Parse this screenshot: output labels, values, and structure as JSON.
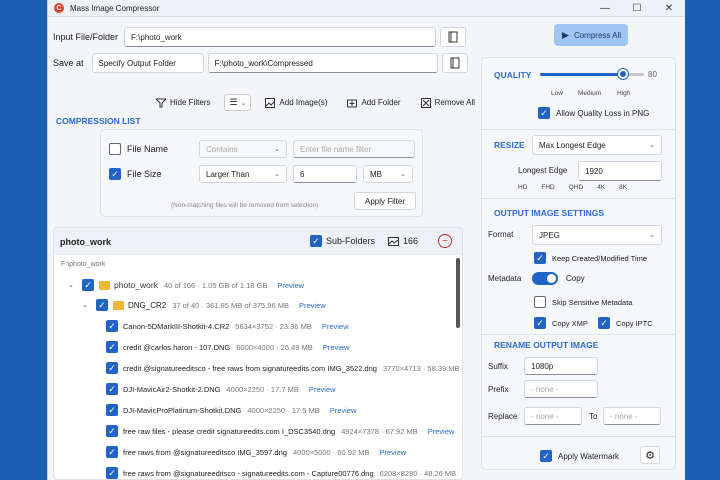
{
  "window": {
    "title": "Mass Image Compressor"
  },
  "input": {
    "label": "Input File/Folder",
    "value": "F:\\photo_work"
  },
  "save": {
    "label": "Save at",
    "mode": "Specify Output Folder",
    "value": "F:\\photo_work\\Compressed"
  },
  "compress_all": "Compress All",
  "toolbar": {
    "hide_filters": "Hide Filters",
    "add_images": "Add Image(s)",
    "add_folder": "Add Folder",
    "remove_all": "Remove All"
  },
  "compression_list": {
    "title": "COMPRESSION LIST",
    "filename": {
      "label": "File Name",
      "op": "Contains",
      "placeholder": "Enter file name filter"
    },
    "filesize": {
      "label": "File Size",
      "op": "Larger Than",
      "value": "6",
      "unit": "MB"
    },
    "note": "(Non-matching files will be removed from selection)",
    "apply": "Apply Filter"
  },
  "tree": {
    "root": "photo_work",
    "subfolders_label": "Sub-Folders",
    "count": "166",
    "path": "F:\\photo_work",
    "rows": [
      {
        "name": "photo_work",
        "size": "40 of 166 · 1.05 GB of 1.18 GB",
        "preview": "Preview"
      },
      {
        "name": "DNG_CR2",
        "size": "37 of 40 · 361.85 MB of 375.96 MB",
        "preview": "Preview"
      },
      {
        "name": "Canon-5DMarkIII-Shotkit-4.CR2",
        "size": "5634×3752 · 23.36 MB",
        "preview": "Preview"
      },
      {
        "name": "credit @carlos.haron - 107.DNG",
        "size": "6000×4000 · 26.49 MB",
        "preview": "Preview"
      },
      {
        "name": "credit @signatureeditsco - free raws from signatureedits.com IMG_3522.dng",
        "size": "3770×4713 · 58.39 MB",
        "preview": ""
      },
      {
        "name": "DJI-MavicAir2-Shotkit-2.DNG",
        "size": "4000×2250 · 17.7 MB",
        "preview": "Preview"
      },
      {
        "name": "DJI-MavicProPlatinum-Shotkit.DNG",
        "size": "4000×2250 · 17.5 MB",
        "preview": "Preview"
      },
      {
        "name": "free raw files - please credit signatureedits.com I_DSC3540.dng",
        "size": "4924×7378 · 67.92 MB",
        "preview": "Preview"
      },
      {
        "name": "free raws from @signatureeditsco IMG_3597.dng",
        "size": "4000×5000 · 60.92 MB",
        "preview": "Preview"
      },
      {
        "name": "free raws from @signatureeditsco - signatureedits.com - Capture00776.dng",
        "size": "6208×8280 · 48.26 MB",
        "preview": ""
      }
    ]
  },
  "quality": {
    "label": "QUALITY",
    "value": "80",
    "low": "Low",
    "medium": "Medium",
    "high": "High",
    "allow_loss": "Allow Quality Loss in PNG",
    "level": 0.8
  },
  "resize": {
    "label": "RESIZE",
    "mode": "Max Longest Edge",
    "edge_label": "Longest Edge",
    "edge_value": "1920",
    "presets": [
      "HD",
      "FHD",
      "QHD",
      "4K",
      "8K"
    ]
  },
  "output": {
    "title": "OUTPUT IMAGE SETTINGS",
    "format_label": "Format",
    "format": "JPEG",
    "keep_dates": "Keep Created/Modified Time",
    "metadata_label": "Metadata",
    "copy": "Copy",
    "skip_sensitive": "Skip Sensitive Metadata",
    "copy_xmp": "Copy XMP",
    "copy_iptc": "Copy IPTC"
  },
  "rename": {
    "title": "RENAME OUTPUT IMAGE",
    "suffix_label": "Suffix",
    "suffix": "1080p",
    "prefix_label": "Prefix",
    "prefix_placeholder": "- none -",
    "replace_label": "Replace",
    "replace_placeholder": "- none -",
    "to_label": "To",
    "to_placeholder": "- none -"
  },
  "watermark": "Apply Watermark"
}
